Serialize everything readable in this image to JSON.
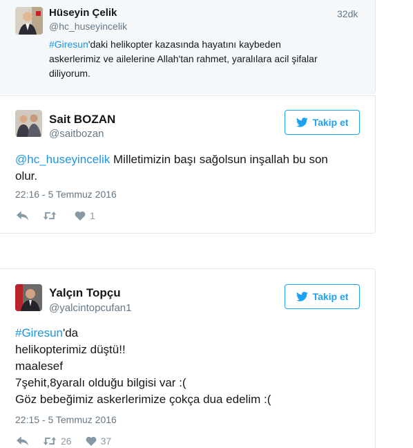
{
  "quoted": {
    "name": "Hüseyin Çelik",
    "handle": "@hc_huseyincelik",
    "time_ago": "32dk",
    "hashtag": "#Giresun",
    "text_line1_rest": "'daki helikopter kazasında hayatını kaybeden",
    "text_line2": "askerlerimiz ve ailelerine Allah'tan rahmet, yaralılara acil şifalar",
    "text_line3": "diliyorum."
  },
  "tweets": [
    {
      "name": "Sait BOZAN",
      "handle": "@saitbozan",
      "follow_label": "Takip et",
      "mention": "@hc_huseyincelik",
      "text_line1_rest": " Milletimizin başı sağolsun inşallah bu son",
      "text_line2": "olur.",
      "timestamp": "22:16 - 5 Temmuz 2016",
      "retweets": "",
      "likes": "1"
    },
    {
      "name": "Yalçın Topçu",
      "handle": "@yalcintopcufan1",
      "follow_label": "Takip et",
      "hashtag": "#Giresun",
      "text_line1_rest": "'da",
      "text_line2": "helikopterimiz düştü!!",
      "text_line3": "maalesef",
      "text_line4": "7şehit,8yaralı olduğu bilgisi var :(",
      "text_line5": "Göz bebeğimiz askerlerimize çokça dua edelim :(",
      "timestamp": "22:15 - 5 Temmuz 2016",
      "retweets": "26",
      "likes": "37"
    }
  ],
  "colors": {
    "accent": "#1da1f2",
    "link": "#1b95e0",
    "muted": "#657786",
    "icon": "#8899a6",
    "quoted_bg": "#f5f8fa"
  },
  "icons": [
    "bird-icon",
    "reply-icon",
    "retweet-icon",
    "heart-icon"
  ]
}
